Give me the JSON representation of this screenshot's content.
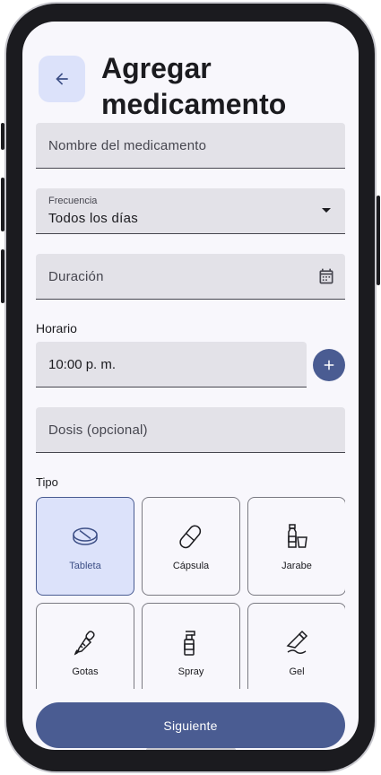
{
  "header": {
    "title": "Agregar medicamento"
  },
  "form": {
    "name_placeholder": "Nombre del medicamento",
    "frequency_label": "Frecuencia",
    "frequency_value": "Todos los días",
    "duration_placeholder": "Duración",
    "schedule_label": "Horario",
    "schedule_value": "10:00 p. m.",
    "dose_placeholder": "Dosis (opcional)",
    "type_label": "Tipo"
  },
  "types": [
    {
      "label": "Tableta",
      "icon": "tablet-icon",
      "selected": true
    },
    {
      "label": "Cápsula",
      "icon": "capsule-icon",
      "selected": false
    },
    {
      "label": "Jarabe",
      "icon": "syrup-icon",
      "selected": false
    },
    {
      "label": "Gotas",
      "icon": "dropper-icon",
      "selected": false
    },
    {
      "label": "Spray",
      "icon": "spray-icon",
      "selected": false
    },
    {
      "label": "Gel",
      "icon": "gel-icon",
      "selected": false
    }
  ],
  "actions": {
    "next_label": "Siguiente"
  },
  "colors": {
    "primary": "#4a5c92",
    "selected_bg": "#dce2fa",
    "field_bg": "#e3e2e8",
    "screen_bg": "#f8f7fc"
  }
}
